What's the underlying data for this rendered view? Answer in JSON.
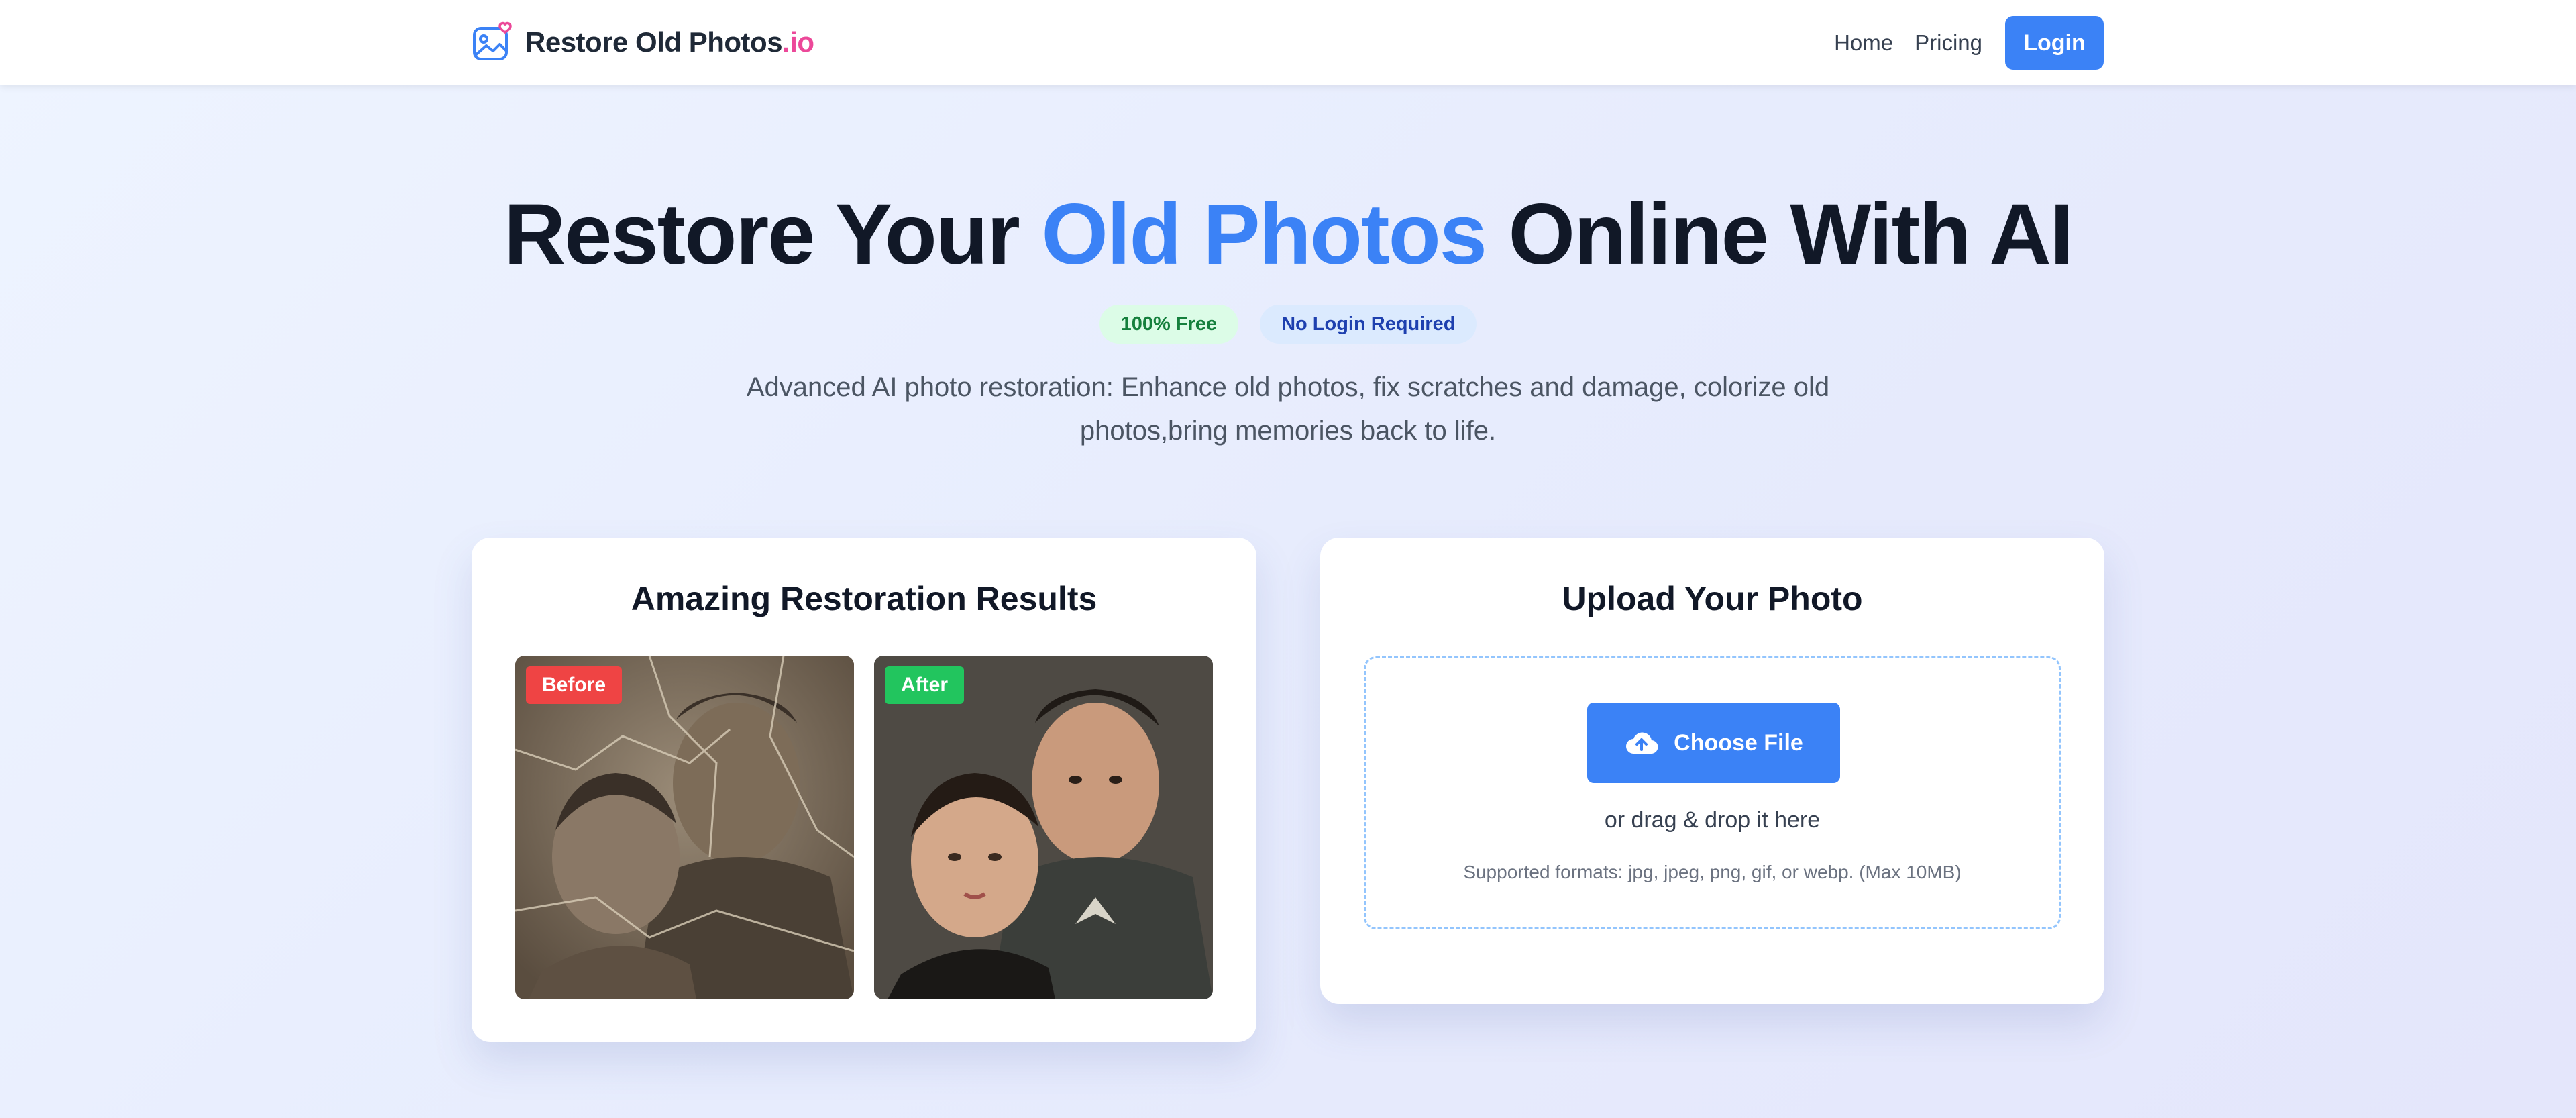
{
  "header": {
    "logo_name": "Restore Old Photos",
    "logo_tld": ".io",
    "logo_icon": "photo-heart-icon",
    "nav": {
      "home": "Home",
      "pricing": "Pricing",
      "login": "Login"
    }
  },
  "hero": {
    "title_part1": "Restore Your ",
    "title_accent": "Old Photos",
    "title_part2": " Online With AI",
    "badge_free": "100% Free",
    "badge_no_login": "No Login Required",
    "subtitle": "Advanced AI photo restoration: Enhance old photos, fix scratches and damage, colorize old photos,bring memories back to life."
  },
  "results_card": {
    "title": "Amazing Restoration Results",
    "before_label": "Before",
    "after_label": "After"
  },
  "upload_card": {
    "title": "Upload Your Photo",
    "choose_file": "Choose File",
    "upload_icon": "cloud-upload-icon",
    "drag_text": "or drag & drop it here",
    "formats": "Supported formats: jpg, jpeg, png, gif, or webp. (Max 10MB)"
  },
  "colors": {
    "accent": "#3b82f6",
    "brand_pink": "#ec4899",
    "before_badge": "#ef4444",
    "after_badge": "#22c55e"
  }
}
